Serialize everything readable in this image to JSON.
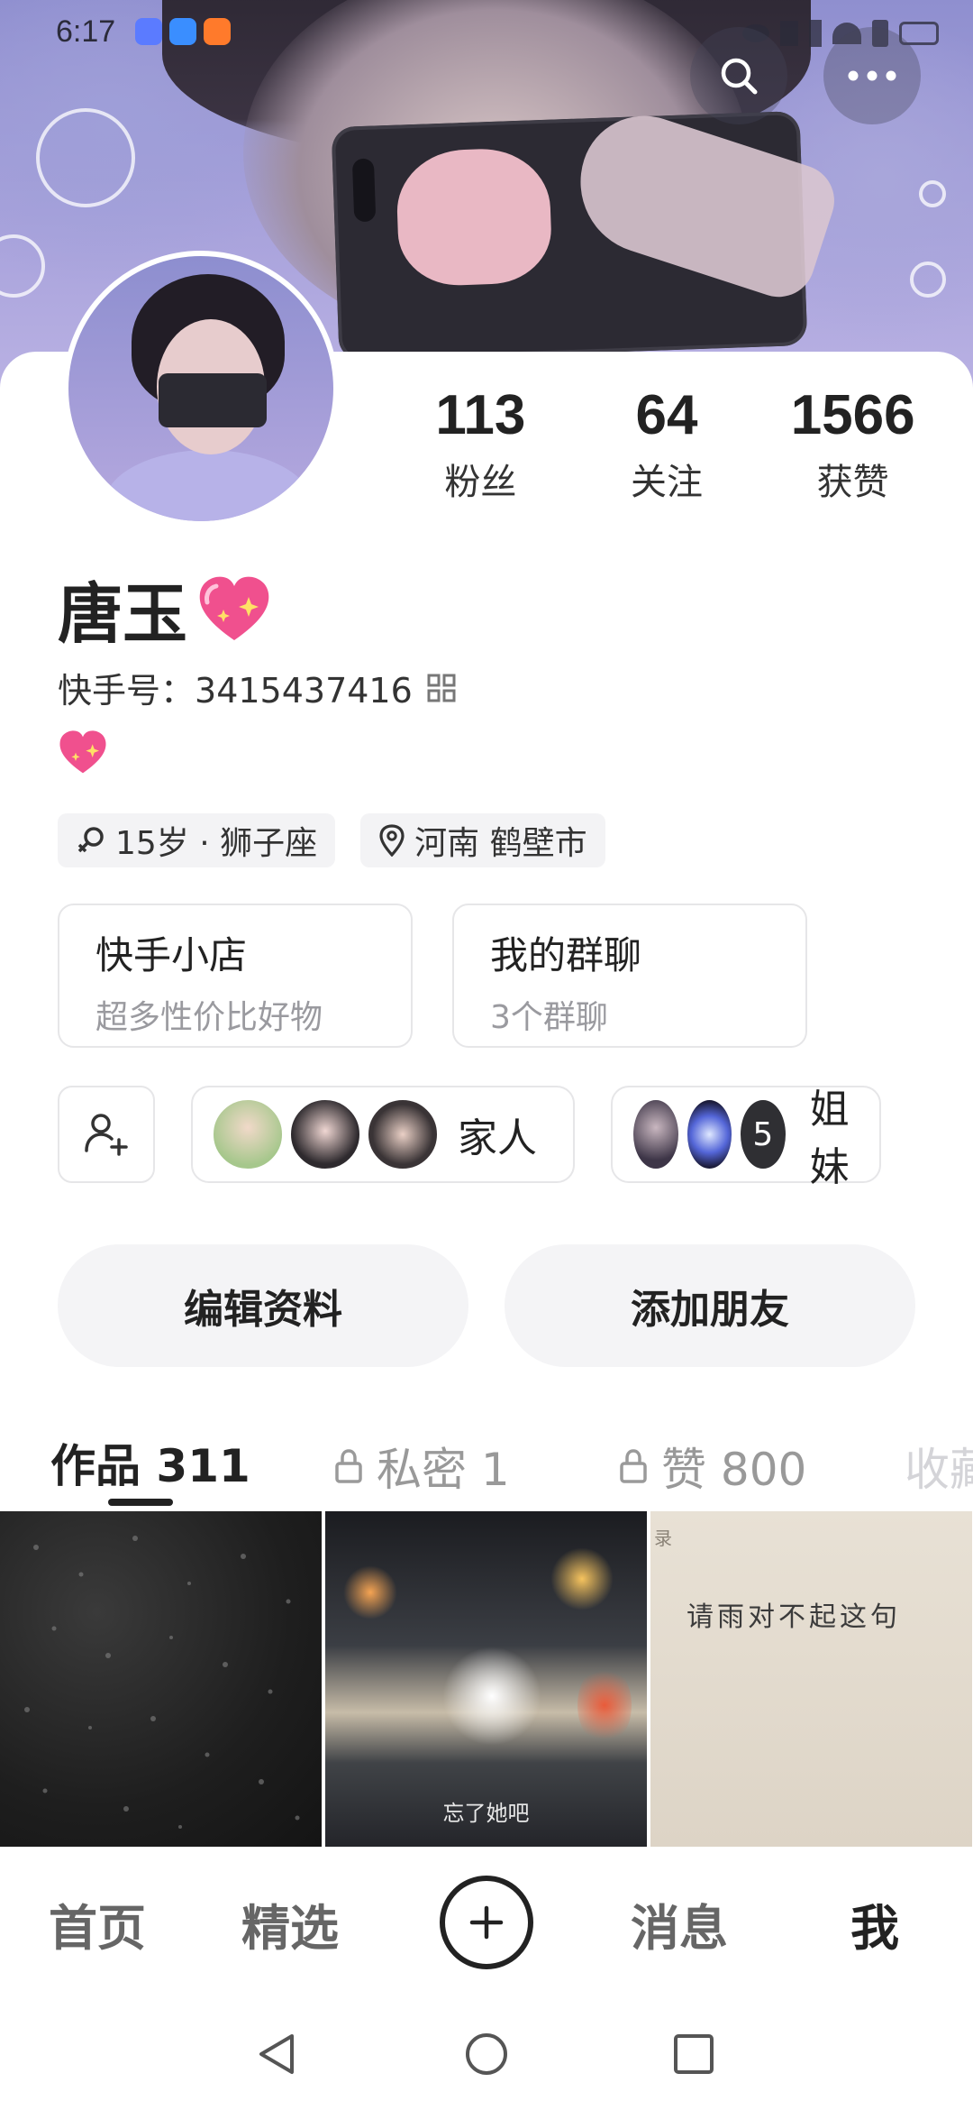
{
  "status_bar": {
    "time": "6:17"
  },
  "profile": {
    "name": "唐玉",
    "id_label": "快手号：",
    "id_value": "3415437416",
    "stats": [
      {
        "value": "113",
        "label": "粉丝"
      },
      {
        "value": "64",
        "label": "关注"
      },
      {
        "value": "1566",
        "label": "获赞"
      }
    ],
    "tags": {
      "age_sign": "15岁 · 狮子座",
      "location": "河南 鹤壁市"
    }
  },
  "feature_cards": [
    {
      "title": "快手小店",
      "subtitle": "超多性价比好物"
    },
    {
      "title": "我的群聊",
      "subtitle": "3个群聊"
    }
  ],
  "groups": [
    {
      "name": "家人"
    },
    {
      "name": "姐妹",
      "more_count": "5"
    }
  ],
  "actions": {
    "edit": "编辑资料",
    "add_friend": "添加朋友"
  },
  "tabs": [
    {
      "label": "作品 311",
      "locked": false
    },
    {
      "label": "私密 1",
      "locked": true
    },
    {
      "label": "赞 800",
      "locked": true
    },
    {
      "label": "收藏",
      "locked": false
    }
  ],
  "grid": {
    "cell2_caption": "忘了她吧",
    "cell3_text": "请雨对不起这句",
    "cell3_corner": "录"
  },
  "bottom_nav": {
    "home": "首页",
    "featured": "精选",
    "messages": "消息",
    "me": "我"
  },
  "colors": {
    "banner": "#9f9fd8",
    "text_primary": "#222222",
    "text_secondary": "#9a9a9f",
    "chip_bg": "#f3f3f5"
  }
}
